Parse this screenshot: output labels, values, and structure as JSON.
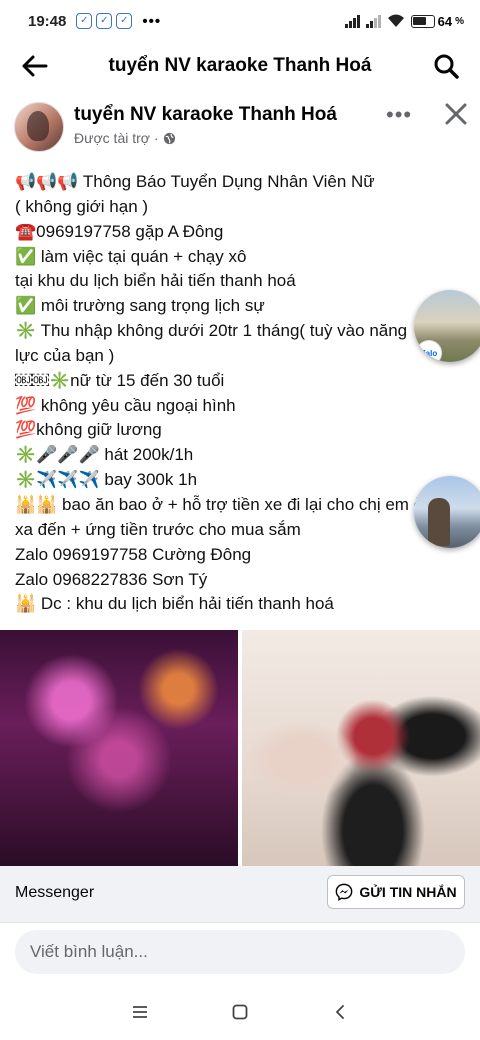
{
  "status_bar": {
    "time": "19:48",
    "battery": "64"
  },
  "app_bar": {
    "title": "tuyển NV karaoke Thanh Hoá"
  },
  "post": {
    "page_name": "tuyển NV karaoke Thanh Hoá",
    "sponsored_label": "Được tài trợ ·",
    "lines": [
      "📢📢📢  Thông Báo Tuyển Dụng Nhân Viên Nữ",
      "( không giới hạn )",
      "☎️0969197758 gặp A Đông",
      "✅ làm việc tại quán + chạy xô",
      "tại khu du lịch biển hải tiến thanh hoá",
      "✅ môi trường sang trọng lịch sự",
      "✳️ Thu nhập không dưới 20tr 1 tháng( tuỳ vào năng",
      "lực của bạn )",
      "￼￼✳️nữ từ 15 đến 30 tuổi",
      "💯 không yêu cầu ngoại hình",
      "💯không giữ lương",
      "✳️🎤🎤🎤 hát 200k/1h",
      "✳️✈️✈️✈️  bay 300k 1h",
      "🕌🕌 bao ăn bao ở + hỗ trợ tiền xe đi lại cho chị em ở",
      "xa đến + ứng tiền trước cho mua sắm",
      "Zalo 0969197758 Cường Đông",
      "Zalo 0968227836 Sơn Tý",
      "🕌 Dc : khu du lịch biển hải tiến thanh hoá"
    ]
  },
  "chat_heads": {
    "zalo_badge": "Zalo"
  },
  "cta": {
    "label": "Messenger",
    "button": "GỬI TIN NHẮN"
  },
  "comment": {
    "placeholder": "Viết bình luận..."
  },
  "icons": {
    "back": "back-arrow-icon",
    "search": "search-icon",
    "more": "more-dots-icon",
    "close": "close-icon",
    "globe": "globe-icon",
    "messenger": "messenger-icon"
  },
  "colors": {
    "secondary_text": "#65676b",
    "surface": "#f0f2f5",
    "zalo_blue": "#0068ff"
  }
}
